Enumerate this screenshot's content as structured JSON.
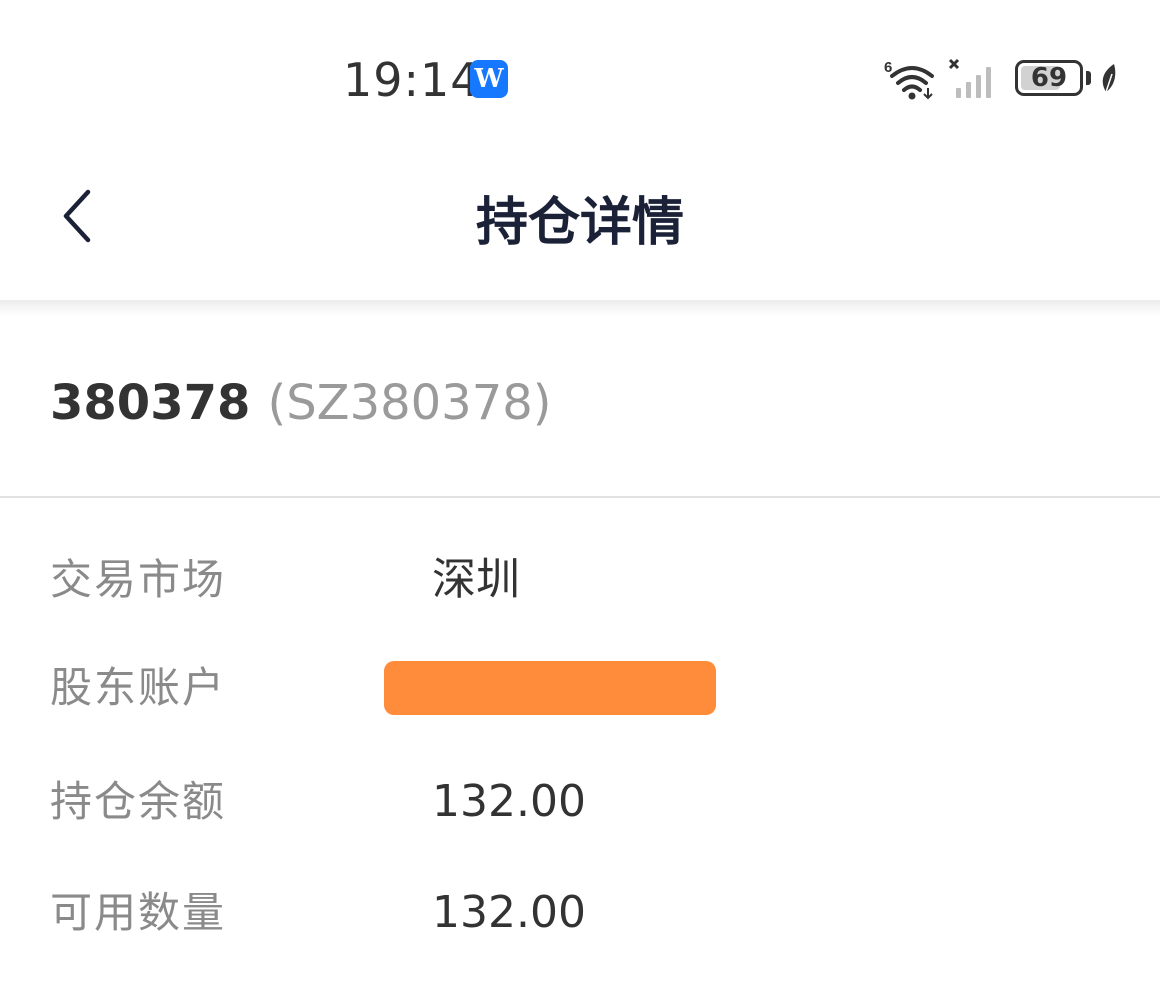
{
  "status_bar": {
    "time": "19:14",
    "app_badge_letter": "W",
    "battery_level": "69",
    "battery_fraction": 0.69,
    "wifi_badge": "6",
    "icons": [
      "wifi-icon",
      "signal-icon",
      "battery-icon",
      "leaf-icon"
    ]
  },
  "nav": {
    "title": "持仓详情",
    "back_icon": "chevron-left-icon"
  },
  "stock": {
    "code": "380378",
    "full_code": "(SZ380378)"
  },
  "details": [
    {
      "label": "交易市场",
      "value": "深圳"
    },
    {
      "label": "股东账户",
      "value": "",
      "redacted": true,
      "redact_color": "#ff8c3a"
    },
    {
      "label": "持仓余额",
      "value": "132.00"
    },
    {
      "label": "可用数量",
      "value": "132.00"
    }
  ],
  "colors": {
    "accent": "#1677ff",
    "title": "#1b2238",
    "label": "#8a8a8a",
    "value": "#333333",
    "redaction": "#ff8c3a"
  }
}
